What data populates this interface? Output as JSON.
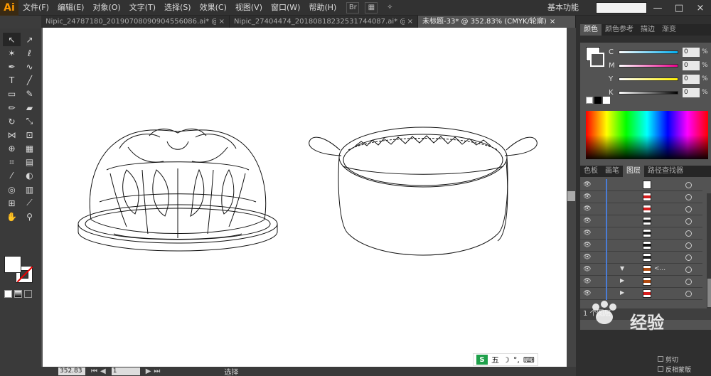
{
  "app": {
    "logo": "Ai",
    "workspace": "基本功能",
    "win_controls": [
      "—",
      "□",
      "×"
    ]
  },
  "menubar": {
    "items": [
      "文件(F)",
      "编辑(E)",
      "对象(O)",
      "文字(T)",
      "选择(S)",
      "效果(C)",
      "视图(V)",
      "窗口(W)",
      "帮助(H)"
    ]
  },
  "tabs": [
    {
      "label": "Nipic_24787180_20190708090904556086.ai* @ 24...",
      "close": "×",
      "active": false
    },
    {
      "label": "Nipic_27404474_20180818232531744087.ai* @ 15...",
      "close": "×",
      "active": false
    },
    {
      "label": "未标题-33* @ 352.83% (CMYK/轮廓)",
      "close": "×",
      "active": true
    }
  ],
  "tools": [
    {
      "icon": "selection-icon",
      "glyph": "↖"
    },
    {
      "icon": "direct-selection-icon",
      "glyph": "↗"
    },
    {
      "icon": "magic-wand-icon",
      "glyph": "✶"
    },
    {
      "icon": "lasso-icon",
      "glyph": "ℓ"
    },
    {
      "icon": "pen-icon",
      "glyph": "✒"
    },
    {
      "icon": "curvature-icon",
      "glyph": "∿"
    },
    {
      "icon": "type-icon",
      "glyph": "T"
    },
    {
      "icon": "line-icon",
      "glyph": "╱"
    },
    {
      "icon": "rectangle-icon",
      "glyph": "▭"
    },
    {
      "icon": "paintbrush-icon",
      "glyph": "✎"
    },
    {
      "icon": "pencil-icon",
      "glyph": "✏"
    },
    {
      "icon": "eraser-icon",
      "glyph": "▰"
    },
    {
      "icon": "rotate-icon",
      "glyph": "↻"
    },
    {
      "icon": "scale-icon",
      "glyph": "⤡"
    },
    {
      "icon": "width-icon",
      "glyph": "⋈"
    },
    {
      "icon": "free-transform-icon",
      "glyph": "⊡"
    },
    {
      "icon": "shape-builder-icon",
      "glyph": "⊕"
    },
    {
      "icon": "perspective-grid-icon",
      "glyph": "▦"
    },
    {
      "icon": "mesh-icon",
      "glyph": "⌗"
    },
    {
      "icon": "gradient-icon",
      "glyph": "▤"
    },
    {
      "icon": "eyedropper-icon",
      "glyph": "⁄"
    },
    {
      "icon": "blend-icon",
      "glyph": "◐"
    },
    {
      "icon": "symbol-sprayer-icon",
      "glyph": "◎"
    },
    {
      "icon": "column-graph-icon",
      "glyph": "▥"
    },
    {
      "icon": "artboard-icon",
      "glyph": "⊞"
    },
    {
      "icon": "slice-icon",
      "glyph": "⟋"
    },
    {
      "icon": "hand-icon",
      "glyph": "✋"
    },
    {
      "icon": "zoom-icon",
      "glyph": "⚲"
    }
  ],
  "statusbar": {
    "zoom": "352.83",
    "page": "1",
    "status": "选择",
    "nav_first": "⏮",
    "nav_prev": "◀",
    "nav_next": "▶",
    "nav_last": "⏭"
  },
  "color_panel": {
    "tabs": [
      "颜色",
      "颜色参考",
      "描边",
      "渐变"
    ],
    "channels": [
      {
        "label": "C",
        "value": "0",
        "unit": "%",
        "color": "#00aeef"
      },
      {
        "label": "M",
        "value": "0",
        "unit": "%",
        "color": "#ec008c"
      },
      {
        "label": "Y",
        "value": "0",
        "unit": "%",
        "color": "#fff200"
      },
      {
        "label": "K",
        "value": "0",
        "unit": "%",
        "color": "#000000"
      }
    ]
  },
  "layers_panel": {
    "tabs": [
      "色板",
      "画笔",
      "图层",
      "路径查找器"
    ],
    "rows": [
      {
        "thumb": "#ffffff",
        "expander": "",
        "name": ""
      },
      {
        "thumb": "#d81e1e",
        "expander": "",
        "name": ""
      },
      {
        "thumb": "#d81e1e",
        "expander": "",
        "name": ""
      },
      {
        "thumb": "#222222",
        "expander": "",
        "name": ""
      },
      {
        "thumb": "#222222",
        "expander": "",
        "name": ""
      },
      {
        "thumb": "#111111",
        "expander": "",
        "name": ""
      },
      {
        "thumb": "#222222",
        "expander": "",
        "name": ""
      },
      {
        "thumb": "#b04a10",
        "expander": "▼",
        "name": "<..."
      },
      {
        "thumb": "#b04a10",
        "expander": "▶",
        "name": ""
      },
      {
        "thumb": "#d81e1e",
        "expander": "▶",
        "name": ""
      }
    ],
    "footer": "1 个图层"
  },
  "ime": {
    "logo": "S",
    "text": "五",
    "moon": "☽",
    "punct": "°,",
    "keyboard": "⌨"
  },
  "watermark": "经验",
  "bottom_right": {
    "opt1": "剪切",
    "opt2": "反相蒙版"
  }
}
